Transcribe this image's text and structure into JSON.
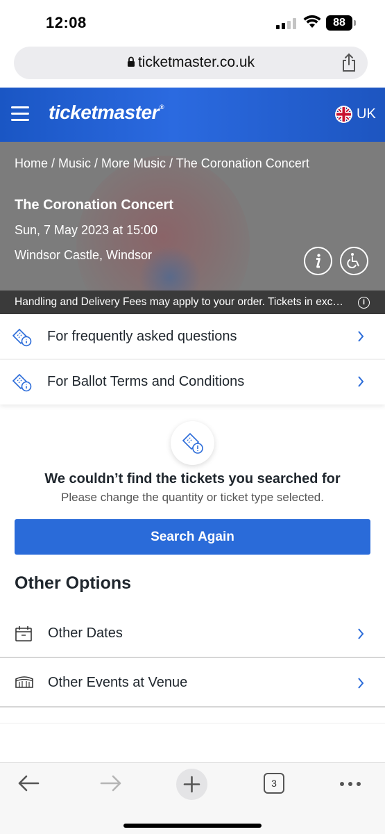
{
  "status_bar": {
    "time": "12:08",
    "battery": "88"
  },
  "browser": {
    "url": "ticketmaster.co.uk"
  },
  "header": {
    "logo": "ticketmaster",
    "region": "UK"
  },
  "event": {
    "breadcrumb": "Home / Music / More Music / The Coronation Concert",
    "title": "The Coronation Concert",
    "date": "Sun, 7 May 2023 at 15:00",
    "venue": "Windsor Castle, Windsor",
    "fees_notice": "Handling and Delivery Fees may apply to your order. Tickets in exc…"
  },
  "info_rows": [
    {
      "label": "For frequently asked questions"
    },
    {
      "label": "For Ballot Terms and Conditions"
    }
  ],
  "empty_state": {
    "title": "We couldn’t find the tickets you searched for",
    "subtitle": "Please change the quantity or ticket type selected.",
    "button": "Search Again"
  },
  "other_options": {
    "title": "Other Options",
    "items": [
      {
        "label": "Other Dates",
        "icon": "calendar-icon"
      },
      {
        "label": "Other Events at Venue",
        "icon": "venue-icon"
      }
    ]
  },
  "toolbar": {
    "tab_count": "3"
  },
  "colors": {
    "brand_blue": "#2a6bd9",
    "header_blue": "#1a56c4"
  }
}
